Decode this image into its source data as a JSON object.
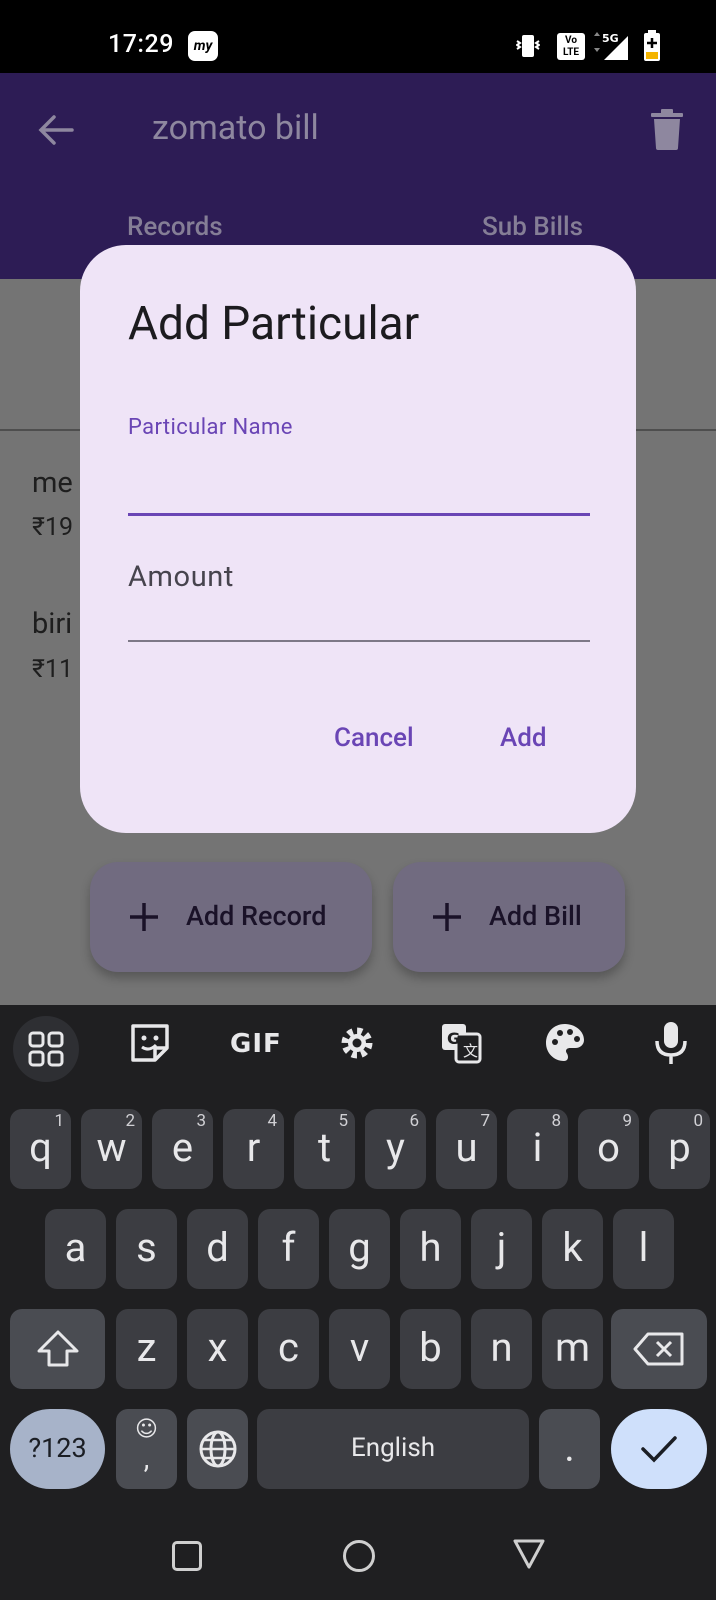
{
  "status_bar": {
    "time": "17:29",
    "brand_badge": "my",
    "lte_label": "Vo LTE",
    "network_label": "5G"
  },
  "app_bar": {
    "title": "zomato bill",
    "tabs": [
      {
        "label": "Records"
      },
      {
        "label": "Sub Bills"
      }
    ]
  },
  "records": [
    {
      "name": "me",
      "amount": "₹19"
    },
    {
      "name": "biri",
      "amount": "₹11"
    }
  ],
  "fabs": {
    "add_record": "Add Record",
    "add_bill": "Add Bill"
  },
  "dialog": {
    "title": "Add Particular",
    "fields": [
      {
        "label": "Particular Name",
        "value": "",
        "focused": true
      },
      {
        "label": "Amount",
        "value": "",
        "focused": false
      }
    ],
    "cancel_label": "Cancel",
    "confirm_label": "Add"
  },
  "keyboard": {
    "toolbar": [
      "apps-grid-icon",
      "sticker-icon",
      "GIF",
      "settings-icon",
      "translate-icon",
      "palette-icon",
      "microphone-icon"
    ],
    "gif_label": "GIF",
    "row1": [
      {
        "k": "q",
        "h": "1"
      },
      {
        "k": "w",
        "h": "2"
      },
      {
        "k": "e",
        "h": "3"
      },
      {
        "k": "r",
        "h": "4"
      },
      {
        "k": "t",
        "h": "5"
      },
      {
        "k": "y",
        "h": "6"
      },
      {
        "k": "u",
        "h": "7"
      },
      {
        "k": "i",
        "h": "8"
      },
      {
        "k": "o",
        "h": "9"
      },
      {
        "k": "p",
        "h": "0"
      }
    ],
    "row2": [
      "a",
      "s",
      "d",
      "f",
      "g",
      "h",
      "j",
      "k",
      "l"
    ],
    "row3": [
      "z",
      "x",
      "c",
      "v",
      "b",
      "n",
      "m"
    ],
    "symbols_label": "?123",
    "comma_label": ",",
    "space_label": "English",
    "period_label": "."
  },
  "colors": {
    "app_bar": "#2d1c55",
    "dialog_bg": "#efe4f7",
    "accent": "#6a45b5",
    "keyboard_bg": "#1f1f21"
  }
}
